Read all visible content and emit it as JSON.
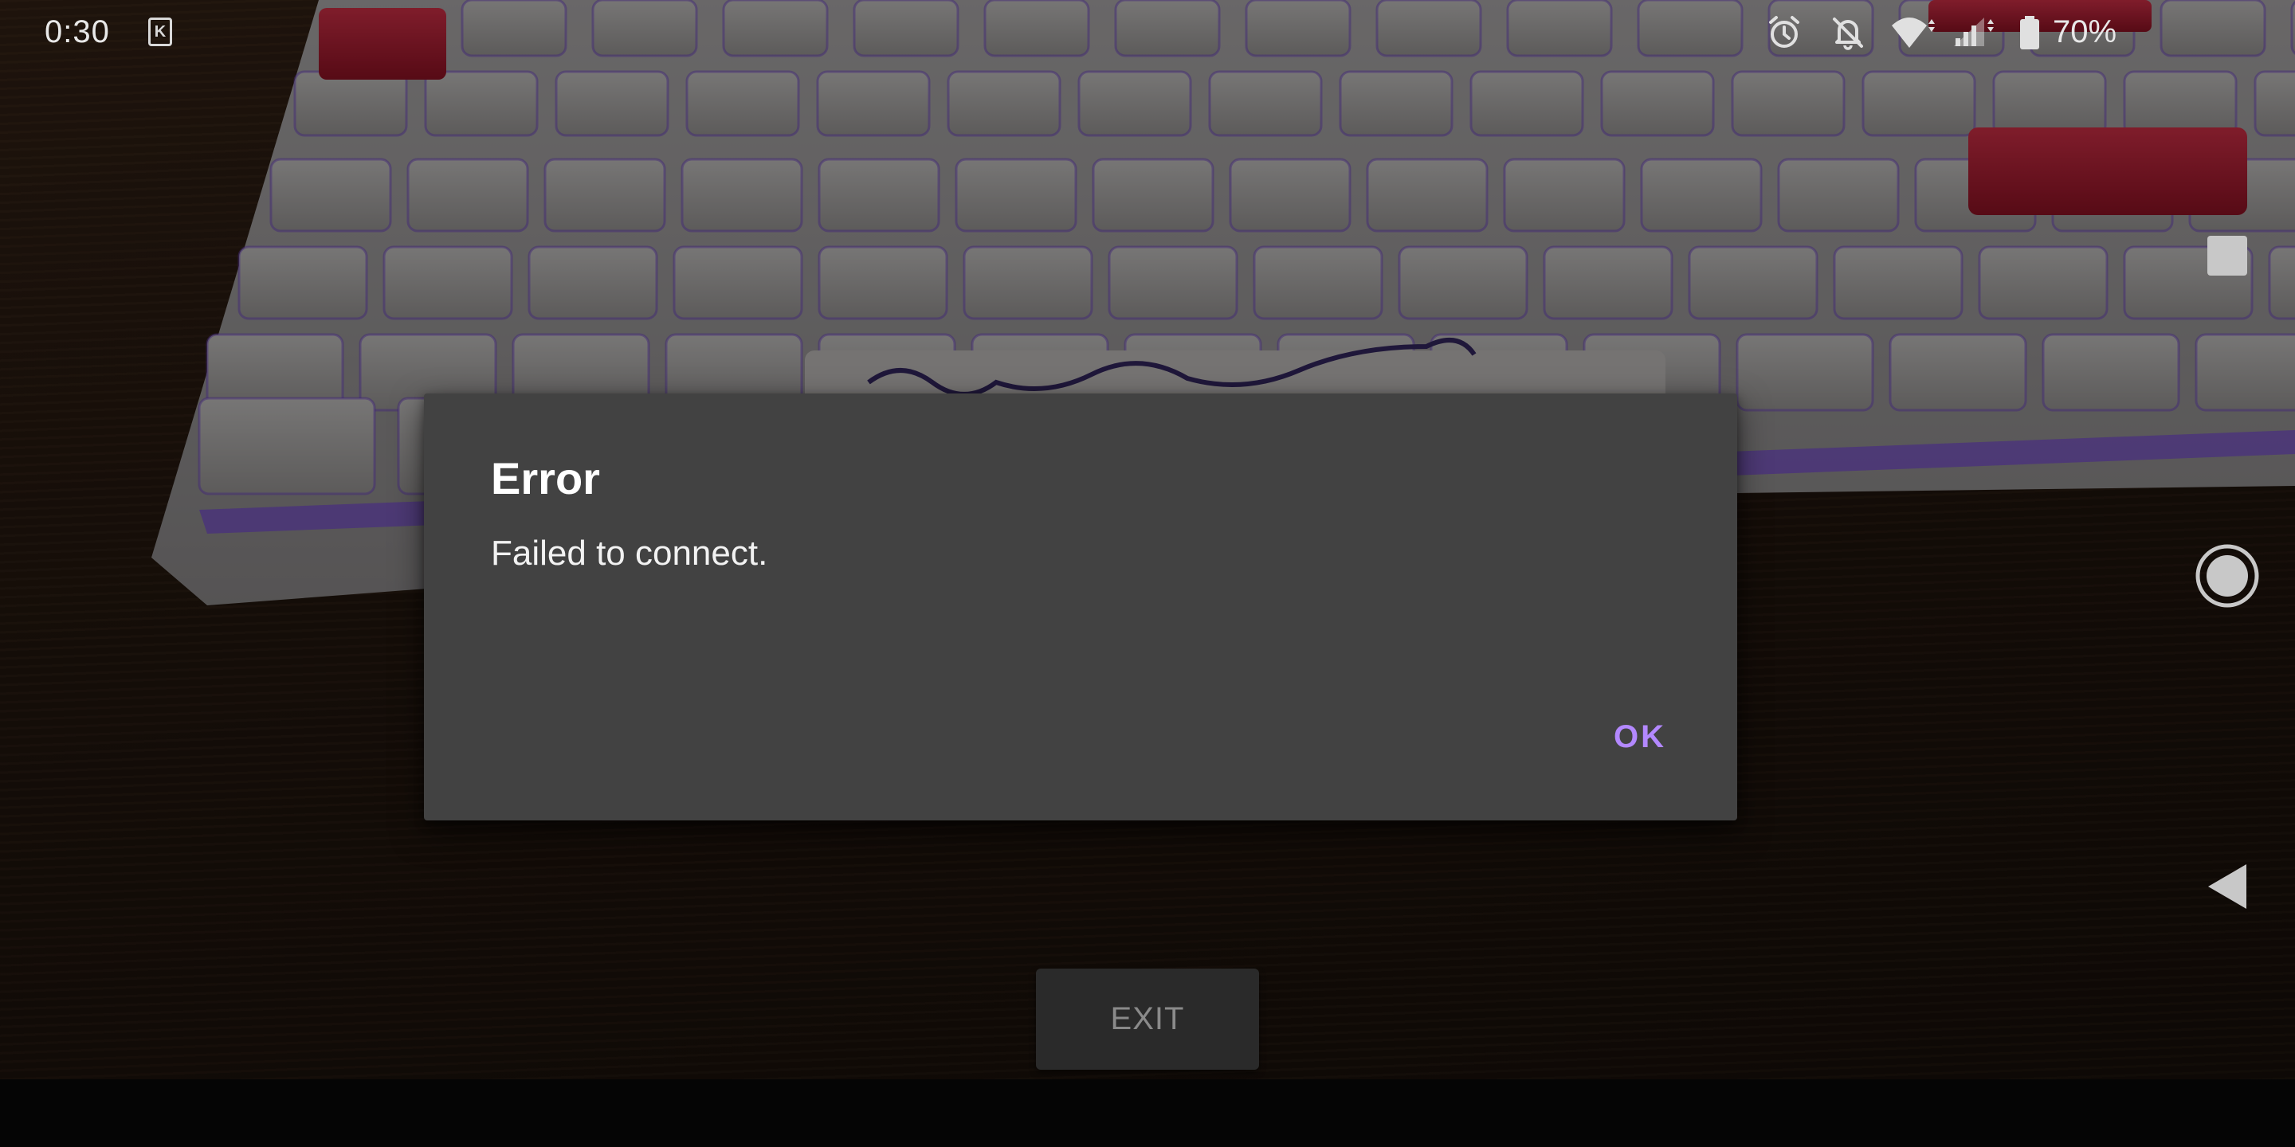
{
  "status_bar": {
    "time": "0:30",
    "notification_app_glyph": "K",
    "icons": [
      "alarm-icon",
      "notifications-off-icon",
      "wifi-icon",
      "cell-signal-icon",
      "battery-icon"
    ],
    "battery_percent": "70%"
  },
  "navigation": {
    "recents": "square-icon",
    "home": "circle-icon",
    "back": "triangle-back-icon"
  },
  "dialog": {
    "title": "Error",
    "message": "Failed to connect.",
    "ok_label": "OK",
    "accent_color": "#b388ff",
    "background_color": "#424242"
  },
  "exit_button": {
    "label": "EXIT"
  }
}
